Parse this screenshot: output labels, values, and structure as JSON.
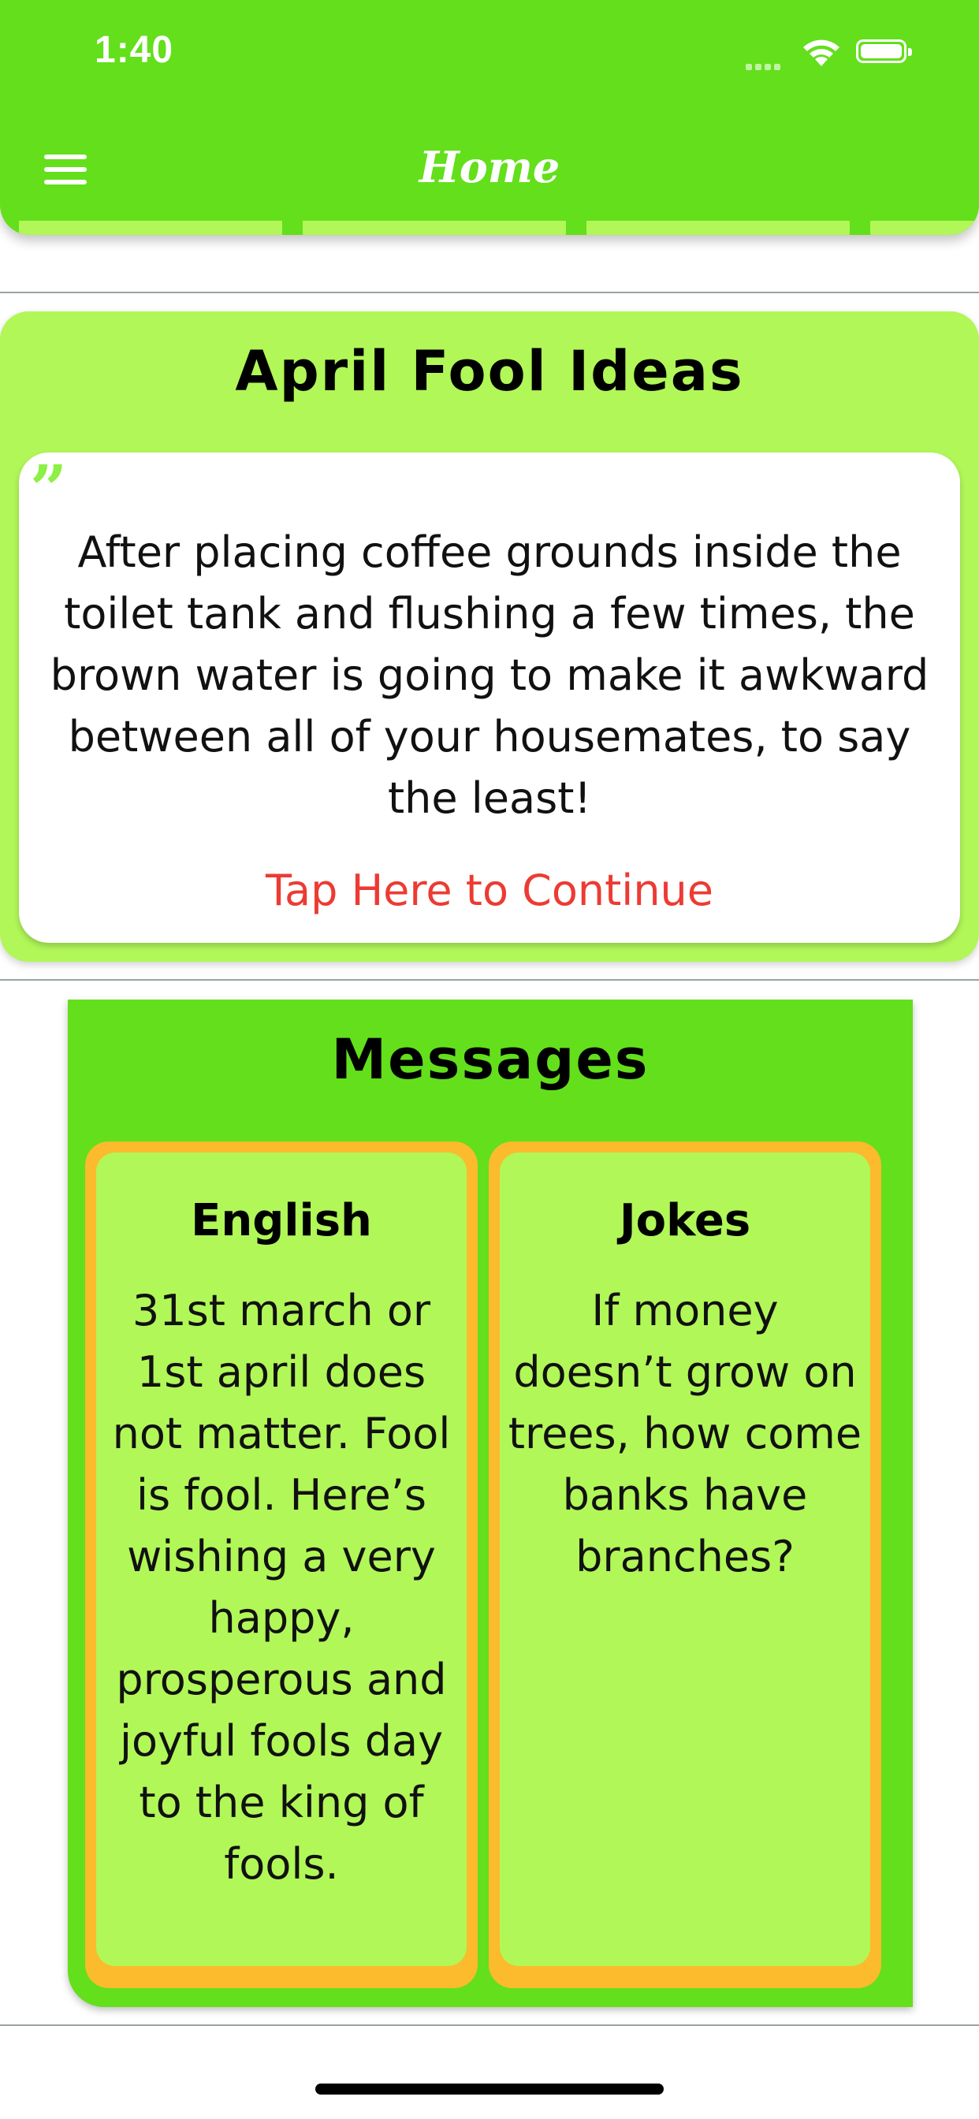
{
  "status_bar": {
    "time": "1:40"
  },
  "header": {
    "title": "Home",
    "menu_icon": "hamburger-menu-icon"
  },
  "ideas": {
    "title": "April Fool Ideas",
    "quote_icon": "quote-icon",
    "quote": "After placing coffee grounds inside the toilet tank and flushing a few times, the brown water is going to make it awkward between all of your housemates, to say the least!",
    "continue_label": "Tap Here to Continue"
  },
  "messages": {
    "title": "Messages",
    "cards": [
      {
        "heading": "English",
        "body": "31st march or 1st april does not matter. Fool is fool. Here’s wishing a very happy, prosperous and joyful fools day to the king of fools."
      },
      {
        "heading": "Jokes",
        "body": "If money doesn’t grow on trees, how come banks have branches?"
      }
    ]
  },
  "colors": {
    "primary_green": "#63DF1C",
    "light_green": "#B1F758",
    "card_orange": "#FBBB2C",
    "link_red": "#EC3B33"
  }
}
